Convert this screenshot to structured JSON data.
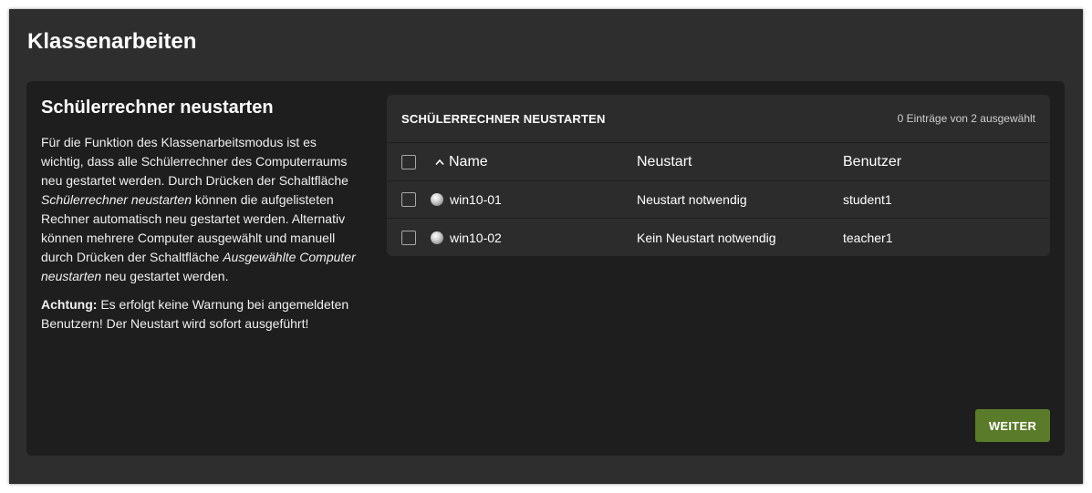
{
  "page": {
    "title": "Klassenarbeiten"
  },
  "info": {
    "heading": "Schülerrechner neustarten",
    "p1_a": "Für die Funktion des Klassenarbeitsmodus ist es wichtig, dass alle Schülerrechner des Computerraums neu gestartet werden. Durch Drücken der Schaltfläche ",
    "p1_b": "Schülerrechner neustarten",
    "p1_c": " können die aufgelisteten Rechner automatisch neu gestartet werden. Alternativ können mehrere Computer ausgewählt und manuell durch Drücken der Schaltfläche ",
    "p1_d": "Ausgewählte Computer neustarten",
    "p1_e": " neu gestartet werden.",
    "p2_label": "Achtung:",
    "p2_text": " Es erfolgt keine Warnung bei angemeldeten Benutzern! Der Neustart wird sofort ausgeführt!"
  },
  "grid": {
    "title": "SCHÜLERRECHNER NEUSTARTEN",
    "selection_status": "0 Einträge von 2 ausgewählt",
    "columns": {
      "name": "Name",
      "neustart": "Neustart",
      "benutzer": "Benutzer"
    },
    "rows": [
      {
        "name": "win10-01",
        "neustart": "Neustart notwendig",
        "benutzer": "student1",
        "icon": "computer-status-icon"
      },
      {
        "name": "win10-02",
        "neustart": "Kein Neustart notwendig",
        "benutzer": "teacher1",
        "icon": "computer-status-icon"
      }
    ]
  },
  "actions": {
    "next_label": "WEITER"
  },
  "colors": {
    "accent": "#5a7b2a",
    "background": "#2e2e2e",
    "card": "#1e1e1e",
    "grid": "#2c2c2c"
  }
}
